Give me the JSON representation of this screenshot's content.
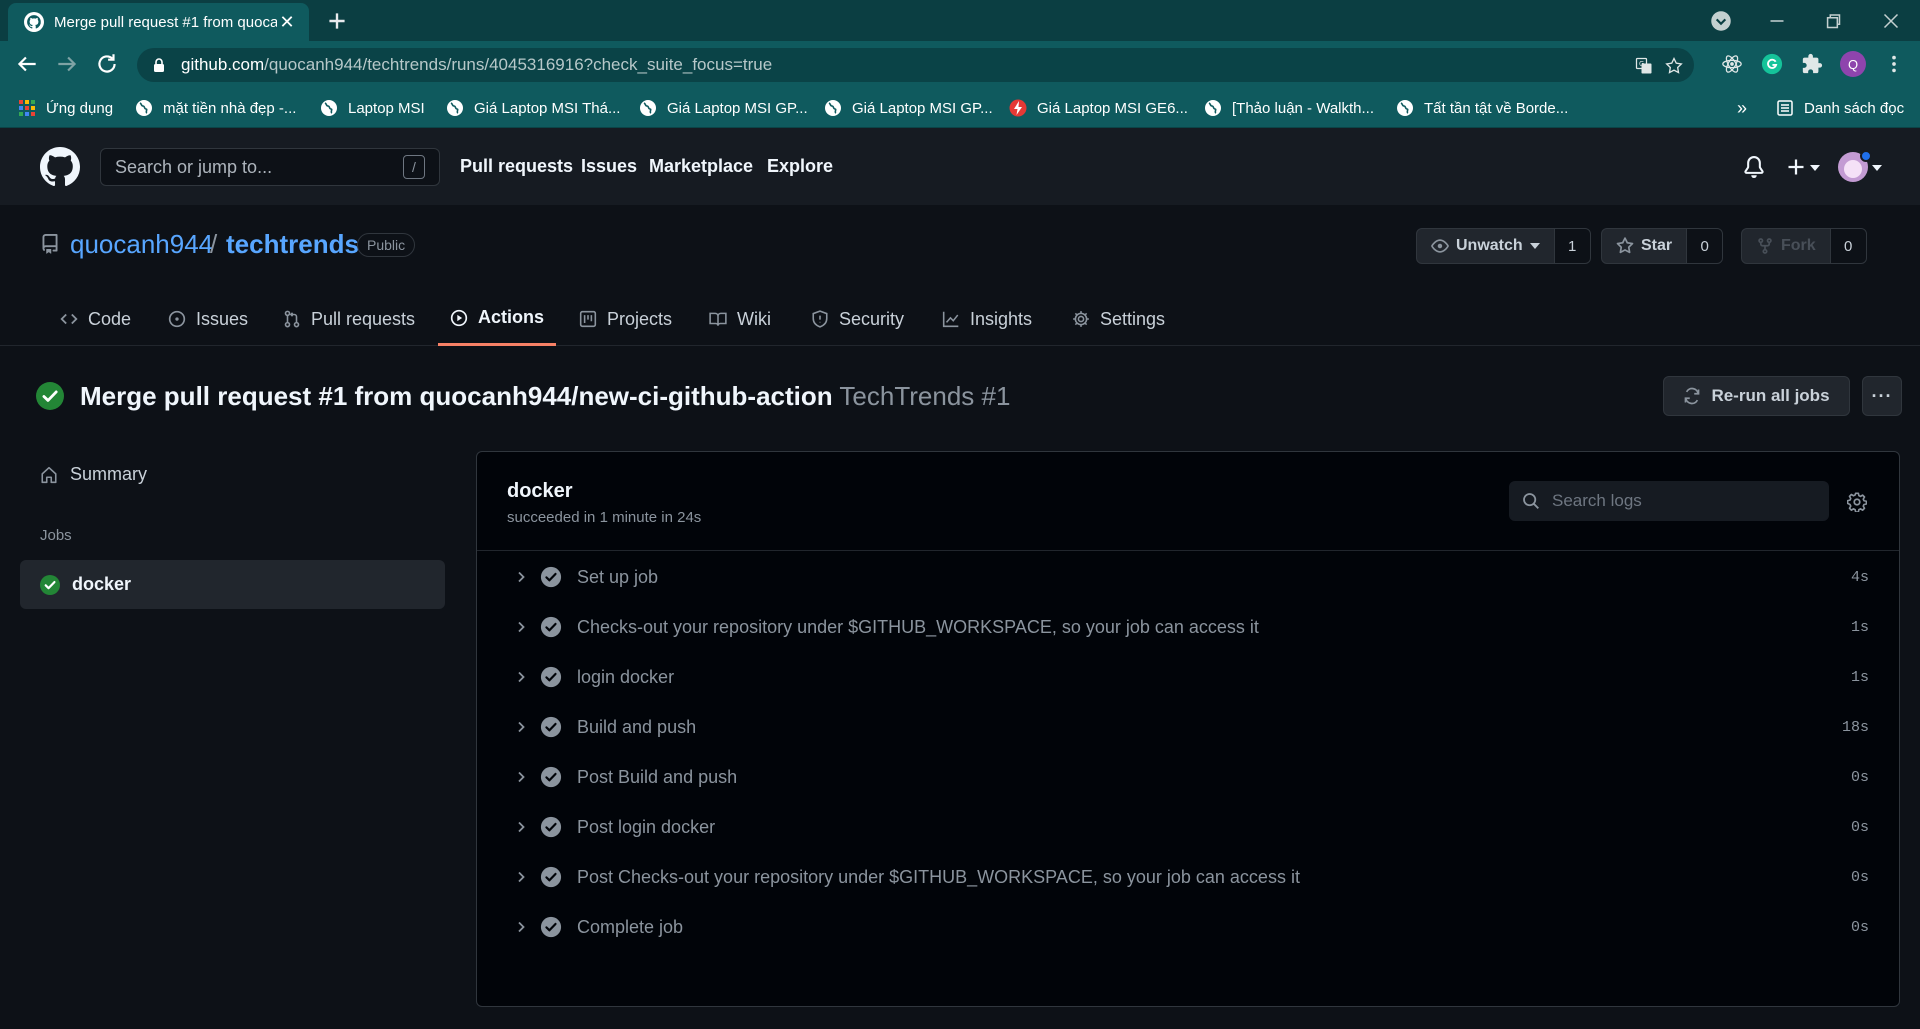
{
  "browser": {
    "tab_title": "Merge pull request #1 from quocanh944/new-ci-github-action",
    "url_host": "github.com",
    "url_rest": "/quocanh944/techtrends/runs/4045316916?check_suite_focus=true",
    "profile_initial": "Q",
    "bookmarks": [
      "Ứng dụng",
      "mặt tiền nhà đẹp -...",
      "Laptop MSI",
      "Giá Laptop MSI Thá...",
      "Giá Laptop MSI GP...",
      "Giá Laptop MSI GP...",
      "Giá Laptop MSI GE6...",
      "[Thảo luận - Walkth...",
      "Tất tần tật về Borde..."
    ],
    "more_bookmarks": "»",
    "reading_list": "Danh sách đọc"
  },
  "github": {
    "search_placeholder": "Search or jump to...",
    "search_key": "/",
    "nav": [
      "Pull requests",
      "Issues",
      "Marketplace",
      "Explore"
    ]
  },
  "repo": {
    "owner": "quocanh944",
    "separator": "/",
    "name": "techtrends",
    "visibility": "Public",
    "watch_label": "Unwatch",
    "watch_count": "1",
    "star_label": "Star",
    "star_count": "0",
    "fork_label": "Fork",
    "fork_count": "0",
    "tabs": [
      "Code",
      "Issues",
      "Pull requests",
      "Actions",
      "Projects",
      "Wiki",
      "Security",
      "Insights",
      "Settings"
    ],
    "selected_tab": "Actions"
  },
  "run": {
    "title": "Merge pull request #1 from quocanh944/new-ci-github-action",
    "workflow": "TechTrends #1",
    "rerun_label": "Re-run all jobs",
    "more_label": "···",
    "status": "success"
  },
  "sidebar": {
    "summary": "Summary",
    "jobs_heading": "Jobs",
    "job": "docker"
  },
  "log": {
    "job_name": "docker",
    "job_status": "succeeded in 1 minute in 24s",
    "search_placeholder": "Search logs",
    "steps": [
      {
        "name": "Set up job",
        "duration": "4s"
      },
      {
        "name": "Checks-out your repository under $GITHUB_WORKSPACE, so your job can access it",
        "duration": "1s"
      },
      {
        "name": "login docker",
        "duration": "1s"
      },
      {
        "name": "Build and push",
        "duration": "18s"
      },
      {
        "name": "Post Build and push",
        "duration": "0s"
      },
      {
        "name": "Post login docker",
        "duration": "0s"
      },
      {
        "name": "Post Checks-out your repository under $GITHUB_WORKSPACE, so your job can access it",
        "duration": "0s"
      },
      {
        "name": "Complete job",
        "duration": "0s"
      }
    ]
  },
  "colors": {
    "success": "#238636",
    "accent_link": "#58a6ff",
    "selected_tab_underline": "#f78166",
    "browser_frame": "#0f5a5e"
  }
}
